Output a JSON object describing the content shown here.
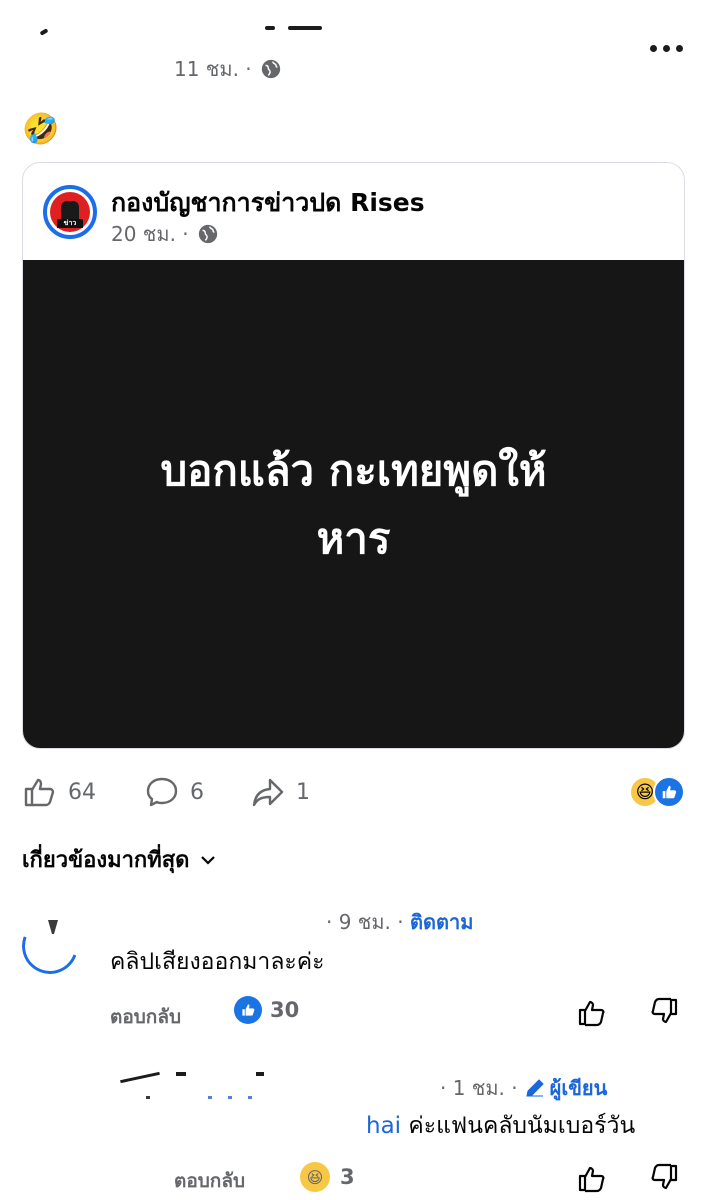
{
  "post": {
    "time": "11 ชม. ·",
    "emoji": "🤣"
  },
  "shared": {
    "page_name": "กองบัญชาการข่าวปด Rises",
    "time": "20 ชม. ·",
    "image_text_line1": "บอกแล้ว กะเทยพูดให้",
    "image_text_line2": "หาร"
  },
  "actions": {
    "likes": "64",
    "comments": "6",
    "shares": "1"
  },
  "sort": {
    "label": "เกี่ยวข้องมากที่สุด"
  },
  "comments": [
    {
      "meta_time": "· 9 ชม. ·",
      "follow": "ติดตาม",
      "text": "คลิปเสียงออกมาละค่ะ",
      "reply": "ตอบกลับ",
      "likes": "30"
    },
    {
      "meta_time": "· 1 ชม. ·",
      "author_badge": "ผู้เขียน",
      "mention": "hai",
      "text": " ค่ะแฟนคลับนัมเบอร์วัน",
      "reply": "ตอบกลับ",
      "reactions": "3"
    }
  ],
  "colors": {
    "accent": "#1b66d8",
    "like_blue": "#1b74e4",
    "muted": "#65676b",
    "image_bg": "#161616"
  }
}
